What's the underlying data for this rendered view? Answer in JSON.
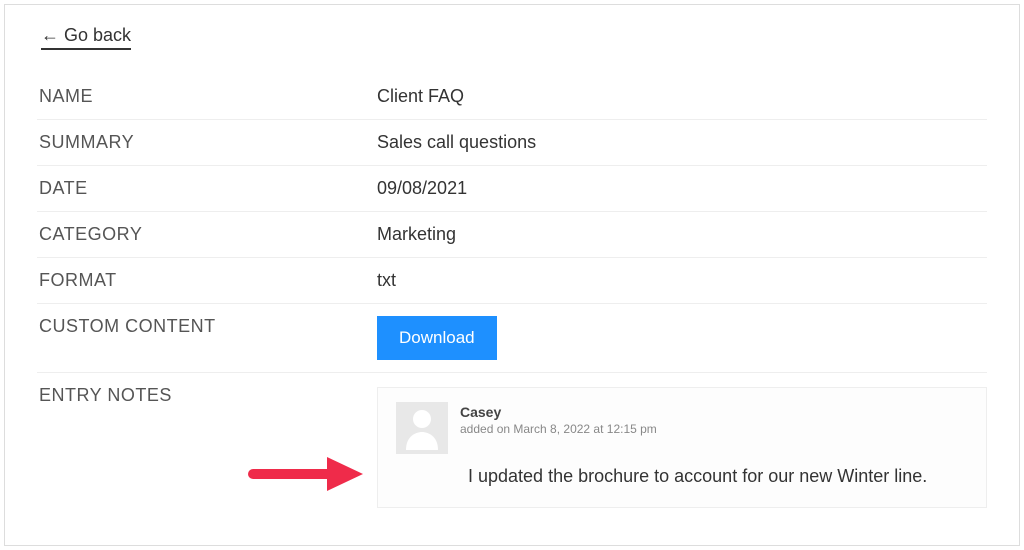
{
  "nav": {
    "go_back": "← Go back"
  },
  "labels": {
    "name": "NAME",
    "summary": "SUMMARY",
    "date": "DATE",
    "category": "CATEGORY",
    "format": "FORMAT",
    "custom_content": "CUSTOM CONTENT",
    "entry_notes": "ENTRY NOTES"
  },
  "values": {
    "name": "Client FAQ",
    "summary": "Sales call questions",
    "date": "09/08/2021",
    "category": "Marketing",
    "format": "txt"
  },
  "actions": {
    "download": "Download"
  },
  "note": {
    "author": "Casey",
    "timestamp": "added on March 8, 2022 at 12:15 pm",
    "body": "I updated the brochure to account for our new Winter line."
  }
}
